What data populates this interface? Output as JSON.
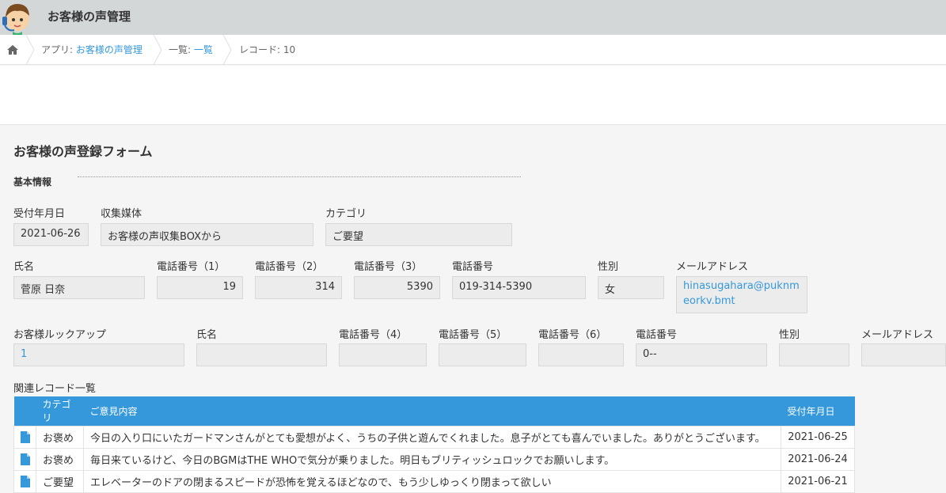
{
  "header": {
    "app_title": "お客様の声管理"
  },
  "breadcrumb": {
    "app_prefix": "アプリ: ",
    "app_link": "お客様の声管理",
    "view_prefix": "一覧: ",
    "view_link": "一覧",
    "record": "レコード: 10"
  },
  "form": {
    "title": "お客様の声登録フォーム",
    "section": "基本情報",
    "fields": {
      "date_label": "受付年月日",
      "date_value": "2021-06-26",
      "media_label": "収集媒体",
      "media_value": "お客様の声収集BOXから",
      "category_label": "カテゴリ",
      "category_value": "ご要望",
      "name_label": "氏名",
      "name_value": "菅原 日奈",
      "tel1_label": "電話番号（1）",
      "tel1_value": "19",
      "tel2_label": "電話番号（2）",
      "tel2_value": "314",
      "tel3_label": "電話番号（3）",
      "tel3_value": "5390",
      "tel_label": "電話番号",
      "tel_value": "019-314-5390",
      "gender_label": "性別",
      "gender_value": "女",
      "email_label": "メールアドレス",
      "email_value": "hinasugahara@puknmeorkv.bmt",
      "lookup_label": "お客様ルックアップ",
      "lookup_value": "1",
      "name2_label": "氏名",
      "name2_value": "",
      "tel4_label": "電話番号（4）",
      "tel4_value": "",
      "tel5_label": "電話番号（5）",
      "tel5_value": "",
      "tel6_label": "電話番号（6）",
      "tel6_value": "",
      "tel2b_label": "電話番号",
      "tel2b_value": "0--",
      "gender2_label": "性別",
      "gender2_value": "",
      "email2_label": "メールアドレス",
      "email2_value": ""
    }
  },
  "related": {
    "label": "関連レコード一覧",
    "columns": [
      "カテゴリ",
      "ご意見内容",
      "受付年月日"
    ],
    "rows": [
      {
        "category": "お褒め",
        "content": "今日の入り口にいたガードマンさんがとても愛想がよく、うちの子供と遊んでくれました。息子がとても喜んでいました。ありがとうございます。",
        "date": "2021-06-25"
      },
      {
        "category": "お褒め",
        "content": "毎日来ているけど、今日のBGMはTHE WHOで気分が乗りました。明日もブリティッシュロックでお願いします。",
        "date": "2021-06-24"
      },
      {
        "category": "ご要望",
        "content": "エレベーターのドアの閉まるスピードが恐怖を覚えるほどなので、もう少しゆっくり閉まって欲しい",
        "date": "2021-06-21"
      }
    ]
  },
  "colors": {
    "accent": "#3498db",
    "topbar": "#d4d7d8"
  }
}
